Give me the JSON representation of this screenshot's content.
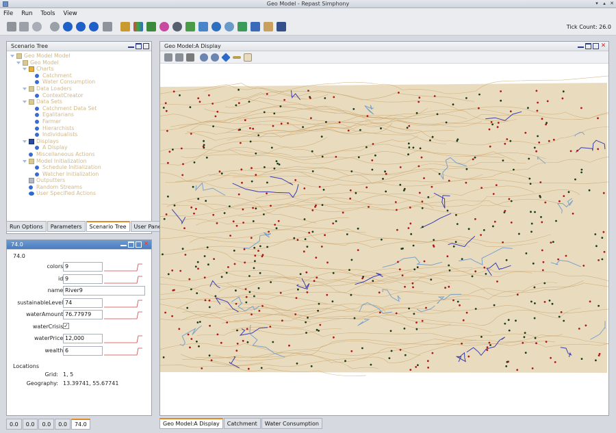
{
  "window": {
    "title": "Geo Model - Repast Simphony"
  },
  "menu": [
    "File",
    "Run",
    "Tools",
    "View"
  ],
  "toolbar": {
    "tick_count": "Tick Count: 26.0"
  },
  "scenario_panel": {
    "title": "Scenario Tree",
    "tree": [
      {
        "label": "Geo Model Model",
        "depth": 0,
        "icon": "folder-icon"
      },
      {
        "label": "Geo Model",
        "depth": 1,
        "icon": "folder-icon"
      },
      {
        "label": "Charts",
        "depth": 2,
        "icon": "chart-icon"
      },
      {
        "label": "Catchment",
        "depth": 3,
        "icon": "item-icon"
      },
      {
        "label": "Water Consumption",
        "depth": 3,
        "icon": "item-icon"
      },
      {
        "label": "Data Loaders",
        "depth": 2,
        "icon": "folder-icon"
      },
      {
        "label": "ContextCreator",
        "depth": 3,
        "icon": "item-icon"
      },
      {
        "label": "Data Sets",
        "depth": 2,
        "icon": "folder-icon"
      },
      {
        "label": "Catchment Data Set",
        "depth": 3,
        "icon": "item-icon"
      },
      {
        "label": "Egalitarians",
        "depth": 3,
        "icon": "item-icon"
      },
      {
        "label": "Farmer",
        "depth": 3,
        "icon": "item-icon"
      },
      {
        "label": "Hierarchists",
        "depth": 3,
        "icon": "item-icon"
      },
      {
        "label": "Individualists",
        "depth": 3,
        "icon": "item-icon"
      },
      {
        "label": "Displays",
        "depth": 2,
        "icon": "display-icon"
      },
      {
        "label": "A Display",
        "depth": 3,
        "icon": "item-icon"
      },
      {
        "label": "Miscellaneous Actions",
        "depth": 2,
        "icon": "item-icon"
      },
      {
        "label": "Model Initialization",
        "depth": 2,
        "icon": "folder-icon"
      },
      {
        "label": "Schedule Initialization",
        "depth": 3,
        "icon": "item-icon"
      },
      {
        "label": "Watcher Initialization",
        "depth": 3,
        "icon": "item-icon"
      },
      {
        "label": "Outputters",
        "depth": 2,
        "icon": "outputter-icon"
      },
      {
        "label": "Random Streams",
        "depth": 2,
        "icon": "item-icon"
      },
      {
        "label": "User Specified Actions",
        "depth": 2,
        "icon": "eye-icon"
      }
    ],
    "tabs": [
      "Run Options",
      "Parameters",
      "Scenario Tree",
      "User Panel"
    ],
    "active_tab": "Scenario Tree"
  },
  "props_panel": {
    "title": "74.0",
    "header": "74.0",
    "fields": [
      {
        "label": "colors:",
        "value": "9",
        "type": "text",
        "spark": true
      },
      {
        "label": "id:",
        "value": "9",
        "type": "text",
        "spark": true
      },
      {
        "label": "name:",
        "value": "River9",
        "type": "wide",
        "spark": false
      },
      {
        "label": "sustainableLevel:",
        "value": "74",
        "type": "text",
        "spark": true
      },
      {
        "label": "waterAmount:",
        "value": "76.77979",
        "type": "text",
        "spark": true
      },
      {
        "label": "waterCrisis:",
        "value": "✓",
        "type": "check",
        "spark": false
      },
      {
        "label": "waterPrice:",
        "value": "12,000",
        "type": "text",
        "spark": true
      },
      {
        "label": "wealth:",
        "value": "6",
        "type": "text",
        "spark": true
      }
    ],
    "locations_label": "Locations",
    "grid_label": "Grid:",
    "grid_value": "1, 5",
    "geography_label": "Geography:",
    "geography_value": "13.39741, 55.67741",
    "bottom_tabs": [
      "0.0",
      "0.0",
      "0.0",
      "0.0",
      "74.0"
    ],
    "active_bottom_tab": "74.0"
  },
  "display_panel": {
    "title": "Geo Model:A Display",
    "tabs": [
      "Geo Model:A Display",
      "Catchment",
      "Water Consumption"
    ],
    "active_tab": "Geo Model:A Display"
  },
  "colors": {
    "map_land": "#e9dcbe",
    "contour": "#c9a36c",
    "river_light": "#7aa0cc",
    "river_dark": "#3a3ab0",
    "agent_red": "#b01818",
    "agent_dark": "#1a3a1a",
    "selected_tab_accent": "#e08a2a"
  }
}
